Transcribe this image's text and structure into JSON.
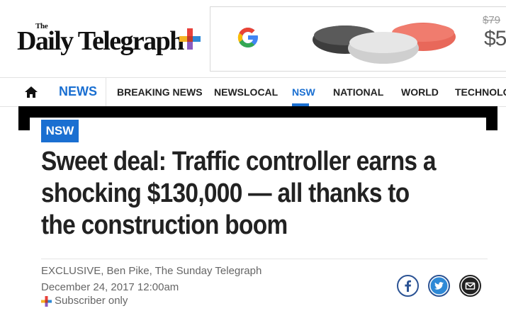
{
  "header": {
    "logo_the": "The",
    "logo_name": "Daily Telegraph"
  },
  "ad": {
    "price_old": "$79",
    "price_new": "$5"
  },
  "nav": {
    "news": "NEWS",
    "items": [
      "BREAKING NEWS",
      "NEWSLOCAL",
      "NSW",
      "NATIONAL",
      "WORLD",
      "TECHNOLO"
    ],
    "active": "NSW"
  },
  "article": {
    "tag": "NSW",
    "headline": "Sweet deal: Traffic controller earns a shocking $130,000 — all thanks to the construction boom",
    "byline": "EXCLUSIVE, Ben Pike, The Sunday Telegraph",
    "date": "December 24, 2017 12:00am",
    "subscriber": "Subscriber only"
  },
  "colors": {
    "accent_blue": "#1a6fd1",
    "plus_red": "#e8413b",
    "plus_yellow": "#f5b324",
    "plus_blue": "#2e89d6",
    "plus_purple": "#8b5bbf"
  },
  "icons": {
    "home": "home-icon",
    "facebook": "facebook-icon",
    "twitter": "twitter-icon",
    "email": "email-icon"
  }
}
